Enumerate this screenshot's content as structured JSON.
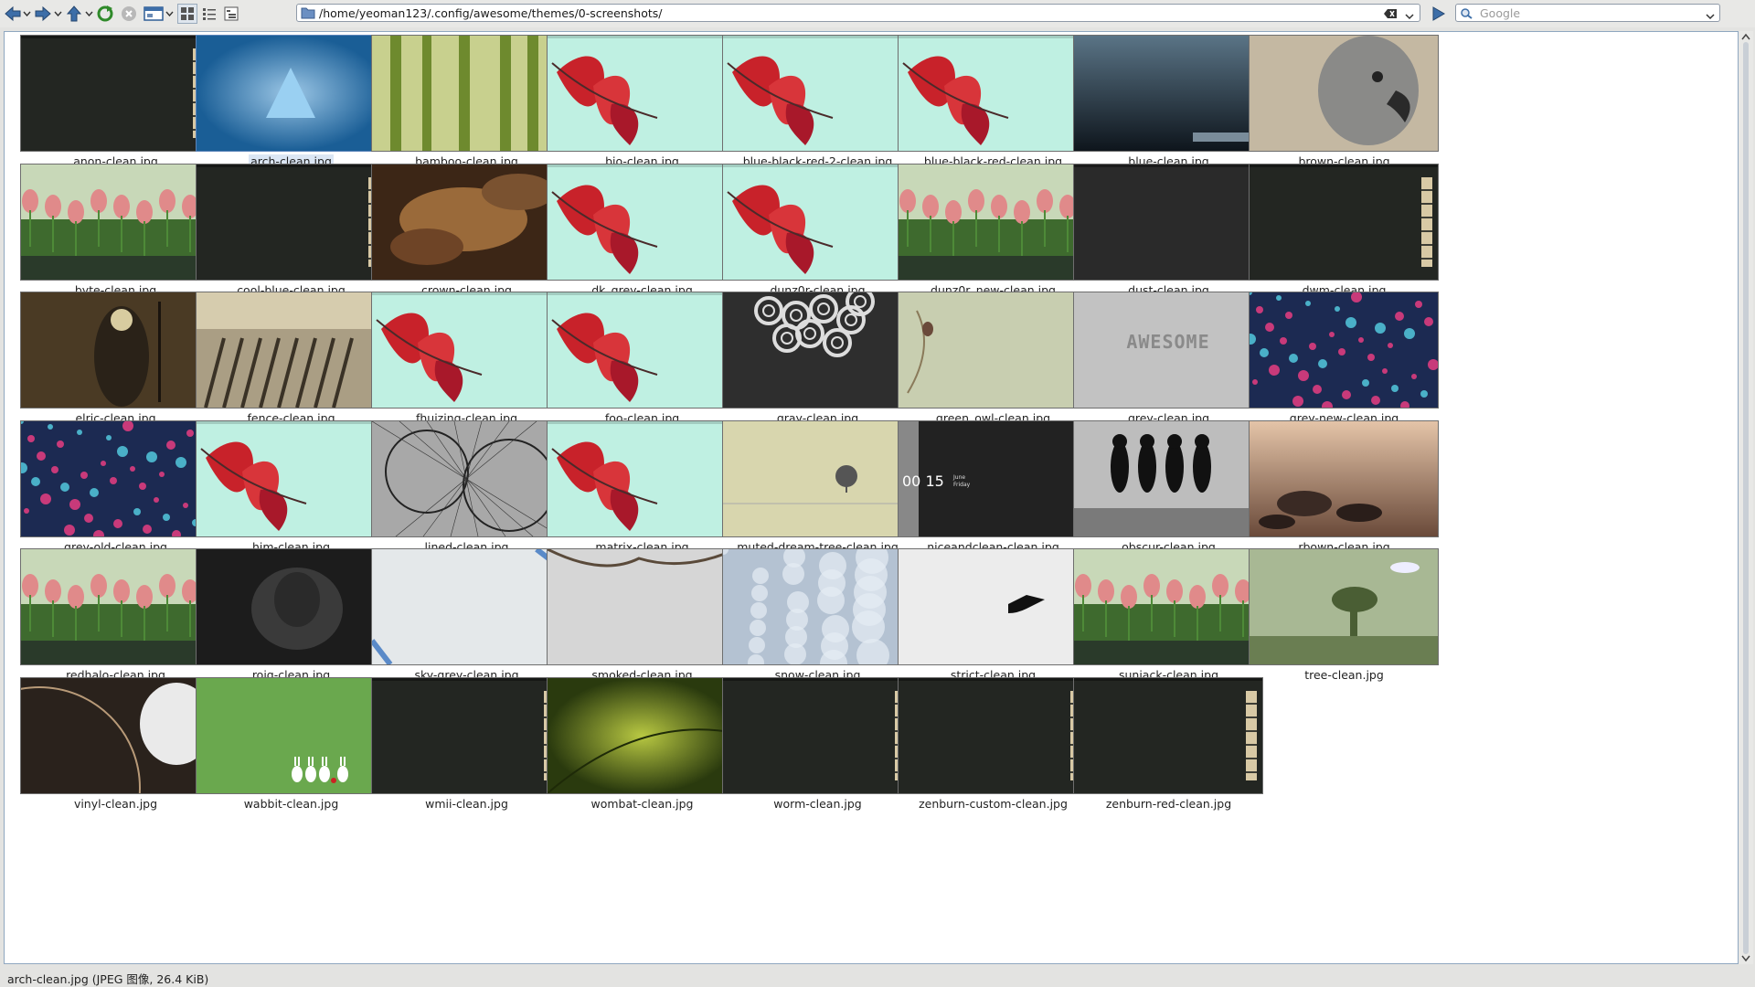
{
  "toolbar": {
    "back_icon": "back-arrow-icon",
    "forward_icon": "forward-arrow-icon",
    "up_icon": "up-arrow-icon",
    "reload_icon": "reload-icon",
    "stop_icon": "stop-icon",
    "view_mode_icon": "view-mode-icon",
    "icons_view_icon": "icons-view-icon",
    "details_view_icon": "details-view-icon",
    "tree_view_icon": "tree-view-icon"
  },
  "location": {
    "path": "/home/yeoman123/.config/awesome/themes/0-screenshots/",
    "clear_icon": "clear-location-icon",
    "go_icon": "go-arrow-icon"
  },
  "search": {
    "placeholder": "Google"
  },
  "files": [
    {
      "name": "anon-clean.jpg",
      "bg": "#232622",
      "motif": "awesome"
    },
    {
      "name": "arch-clean.jpg",
      "bg": "#1f6ea8",
      "motif": "arch"
    },
    {
      "name": "bamboo-clean.jpg",
      "bg": "#a4b26a",
      "motif": "bamboo"
    },
    {
      "name": "bio-clean.jpg",
      "bg": "#bff0e2",
      "motif": "leaf"
    },
    {
      "name": "blue-black-red-2-clean.jpg",
      "bg": "#bff0e2",
      "motif": "leaf"
    },
    {
      "name": "blue-black-red-clean.jpg",
      "bg": "#bff0e2",
      "motif": "leaf"
    },
    {
      "name": "blue-clean.jpg",
      "bg": "#324452",
      "motif": "blue"
    },
    {
      "name": "brown-clean.jpg",
      "bg": "#c8bca8",
      "motif": "parrot"
    },
    {
      "name": "byte-clean.jpg",
      "bg": "#6a8c58",
      "motif": "tulip"
    },
    {
      "name": "cool-blue-clean.jpg",
      "bg": "#232622",
      "motif": "awesome"
    },
    {
      "name": "crown-clean.jpg",
      "bg": "#4c3220",
      "motif": "crown"
    },
    {
      "name": "dk_grey-clean.jpg",
      "bg": "#bff0e2",
      "motif": "leaf"
    },
    {
      "name": "dunz0r-clean.jpg",
      "bg": "#bff0e2",
      "motif": "leaf"
    },
    {
      "name": "dunz0r_new-clean.jpg",
      "bg": "#6a8c58",
      "motif": "tulip"
    },
    {
      "name": "dust-clean.jpg",
      "bg": "#2a2a2a",
      "motif": "plain"
    },
    {
      "name": "dwm-clean.jpg",
      "bg": "#232622",
      "motif": "awesome"
    },
    {
      "name": "elric-clean.jpg",
      "bg": "#3c3020",
      "motif": "elric"
    },
    {
      "name": "fence-clean.jpg",
      "bg": "#9a8e74",
      "motif": "fence"
    },
    {
      "name": "fhuizing-clean.jpg",
      "bg": "#bff0e2",
      "motif": "leaf"
    },
    {
      "name": "foo-clean.jpg",
      "bg": "#bff0e2",
      "motif": "leaf"
    },
    {
      "name": "gray-clean.jpg",
      "bg": "#2e2e2e",
      "motif": "circles"
    },
    {
      "name": "green_owl-clean.jpg",
      "bg": "#c8ceb0",
      "motif": "owl"
    },
    {
      "name": "grey-clean.jpg",
      "bg": "#c2c2c2",
      "motif": "grey"
    },
    {
      "name": "grey-new-clean.jpg",
      "bg": "#24305a",
      "motif": "flowers"
    },
    {
      "name": "grey-old-clean.jpg",
      "bg": "#24305a",
      "motif": "flowers"
    },
    {
      "name": "him-clean.jpg",
      "bg": "#bff0e2",
      "motif": "leaf"
    },
    {
      "name": "lined-clean.jpg",
      "bg": "#9a9a9a",
      "motif": "lined"
    },
    {
      "name": "matrix-clean.jpg",
      "bg": "#bff0e2",
      "motif": "leaf"
    },
    {
      "name": "muted-dream-tree-clean.jpg",
      "bg": "#d8d6ae",
      "motif": "muted"
    },
    {
      "name": "niceandclean-clean.jpg",
      "bg": "#222222",
      "motif": "clock"
    },
    {
      "name": "obscur-clean.jpg",
      "bg": "#bdbdbd",
      "motif": "obscur"
    },
    {
      "name": "rbown-clean.jpg",
      "bg": "#c49a80",
      "motif": "rbown"
    },
    {
      "name": "redhalo-clean.jpg",
      "bg": "#6a8c58",
      "motif": "tulip"
    },
    {
      "name": "roig-clean.jpg",
      "bg": "#1c1c1c",
      "motif": "roig"
    },
    {
      "name": "sky-grey-clean.jpg",
      "bg": "#e4e8ea",
      "motif": "sky"
    },
    {
      "name": "smoked-clean.jpg",
      "bg": "#d6d6d6",
      "motif": "smoked"
    },
    {
      "name": "snow-clean.jpg",
      "bg": "#b4c2d2",
      "motif": "snow"
    },
    {
      "name": "strict-clean.jpg",
      "bg": "#ececec",
      "motif": "strict"
    },
    {
      "name": "sunjack-clean.jpg",
      "bg": "#6a8c58",
      "motif": "tulip"
    },
    {
      "name": "tree-clean.jpg",
      "bg": "#9aae82",
      "motif": "tree"
    },
    {
      "name": "vinyl-clean.jpg",
      "bg": "#3a3028",
      "motif": "vinyl"
    },
    {
      "name": "wabbit-clean.jpg",
      "bg": "#6aa84e",
      "motif": "wabbit"
    },
    {
      "name": "wmii-clean.jpg",
      "bg": "#232622",
      "motif": "awesome"
    },
    {
      "name": "wombat-clean.jpg",
      "bg": "#4e6a1e",
      "motif": "wombat"
    },
    {
      "name": "worm-clean.jpg",
      "bg": "#232622",
      "motif": "awesome"
    },
    {
      "name": "zenburn-custom-clean.jpg",
      "bg": "#232622",
      "motif": "awesome"
    },
    {
      "name": "zenburn-red-clean.jpg",
      "bg": "#232622",
      "motif": "awesome"
    }
  ],
  "selected_file": "arch-clean.jpg",
  "focused_file": "anon-clean.jpg",
  "grey_thumb_text": "AWESOME",
  "clock_thumb": {
    "time": "00 15",
    "day": "June",
    "weekday": "Friday"
  },
  "status": "arch-clean.jpg (JPEG 图像, 26.4 KiB)"
}
